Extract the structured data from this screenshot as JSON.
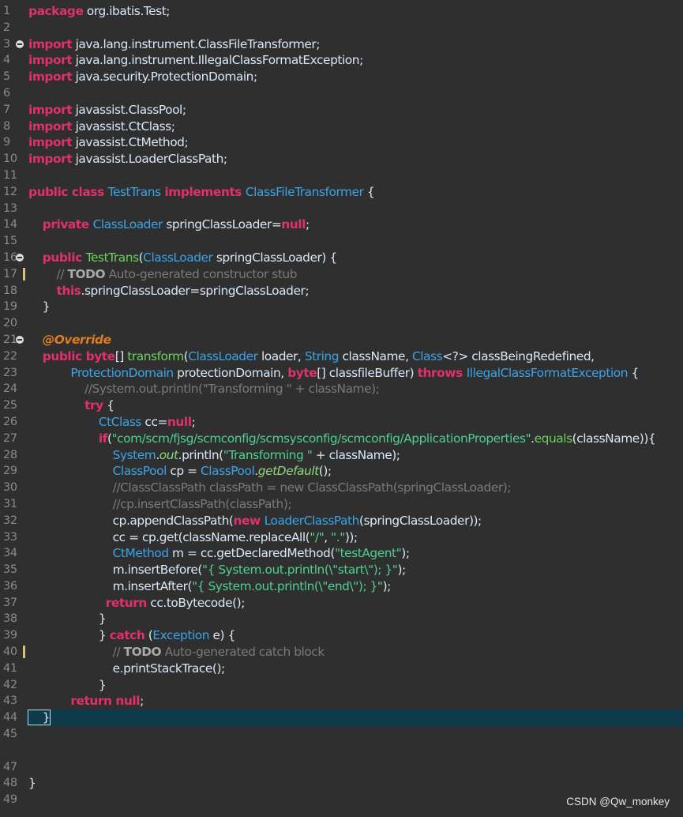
{
  "watermark": "CSDN @Qw_monkey",
  "colors": {
    "background": "#2f2f2f",
    "keyword": "#e0306e",
    "type": "#3aa4e8",
    "method": "#6fd160",
    "string": "#4fcf90",
    "comment": "#7a7a7a",
    "annotation": "#e07a1f",
    "current_line": "#0f3a4a"
  },
  "lines": [
    {
      "n": "1",
      "tokens": [
        [
          "kw",
          "package"
        ],
        [
          "plain",
          " org.ibatis.Test;"
        ]
      ]
    },
    {
      "n": "2",
      "tokens": []
    },
    {
      "n": "3",
      "fold": true,
      "tokens": [
        [
          "kw",
          "import"
        ],
        [
          "plain",
          " java.lang.instrument.ClassFileTransformer;"
        ]
      ]
    },
    {
      "n": "4",
      "tokens": [
        [
          "kw",
          "import"
        ],
        [
          "plain",
          " java.lang.instrument.IllegalClassFormatException;"
        ]
      ]
    },
    {
      "n": "5",
      "tokens": [
        [
          "kw",
          "import"
        ],
        [
          "plain",
          " java.security.ProtectionDomain;"
        ]
      ]
    },
    {
      "n": "6",
      "tokens": []
    },
    {
      "n": "7",
      "tokens": [
        [
          "kw",
          "import"
        ],
        [
          "plain",
          " javassist.ClassPool;"
        ]
      ]
    },
    {
      "n": "8",
      "tokens": [
        [
          "kw",
          "import"
        ],
        [
          "plain",
          " javassist.CtClass;"
        ]
      ]
    },
    {
      "n": "9",
      "tokens": [
        [
          "kw",
          "import"
        ],
        [
          "plain",
          " javassist.CtMethod;"
        ]
      ]
    },
    {
      "n": "10",
      "tokens": [
        [
          "kw",
          "import"
        ],
        [
          "plain",
          " javassist.LoaderClassPath;"
        ]
      ]
    },
    {
      "n": "11",
      "tokens": []
    },
    {
      "n": "12",
      "tokens": [
        [
          "kw",
          "public class "
        ],
        [
          "type",
          "TestTrans"
        ],
        [
          "kw",
          " implements "
        ],
        [
          "type",
          "ClassFileTransformer"
        ],
        [
          "plain",
          " {"
        ]
      ]
    },
    {
      "n": "13",
      "tokens": []
    },
    {
      "n": "14",
      "tokens": [
        [
          "plain",
          "    "
        ],
        [
          "kw",
          "private "
        ],
        [
          "type",
          "ClassLoader"
        ],
        [
          "plain",
          " springClassLoader="
        ],
        [
          "kw",
          "null"
        ],
        [
          "plain",
          ";"
        ]
      ]
    },
    {
      "n": "15",
      "tokens": []
    },
    {
      "n": "16",
      "fold": true,
      "tokens": [
        [
          "plain",
          "    "
        ],
        [
          "kw",
          "public "
        ],
        [
          "method",
          "TestTrans"
        ],
        [
          "plain",
          "("
        ],
        [
          "type",
          "ClassLoader"
        ],
        [
          "plain",
          " springClassLoader) {"
        ]
      ]
    },
    {
      "n": "17",
      "mark": true,
      "tokens": [
        [
          "plain",
          "        "
        ],
        [
          "cm",
          "// "
        ],
        [
          "todo",
          "TODO"
        ],
        [
          "cm",
          " Auto-generated constructor stub"
        ]
      ]
    },
    {
      "n": "18",
      "tokens": [
        [
          "plain",
          "        "
        ],
        [
          "kw",
          "this"
        ],
        [
          "plain",
          ".springClassLoader=springClassLoader;"
        ]
      ]
    },
    {
      "n": "19",
      "tokens": [
        [
          "plain",
          "    }"
        ]
      ]
    },
    {
      "n": "20",
      "tokens": []
    },
    {
      "n": "21",
      "fold": true,
      "tokens": [
        [
          "plain",
          "    "
        ],
        [
          "ann",
          "@Override"
        ]
      ]
    },
    {
      "n": "22",
      "tokens": [
        [
          "plain",
          "    "
        ],
        [
          "kw",
          "public byte"
        ],
        [
          "plain",
          "[] "
        ],
        [
          "method",
          "transform"
        ],
        [
          "plain",
          "("
        ],
        [
          "type",
          "ClassLoader"
        ],
        [
          "plain",
          " loader, "
        ],
        [
          "type",
          "String"
        ],
        [
          "plain",
          " className, "
        ],
        [
          "type",
          "Class"
        ],
        [
          "plain",
          "<?> classBeingRedefined,"
        ]
      ]
    },
    {
      "n": "23",
      "tokens": [
        [
          "plain",
          "            "
        ],
        [
          "type",
          "ProtectionDomain"
        ],
        [
          "plain",
          " protectionDomain, "
        ],
        [
          "kw",
          "byte"
        ],
        [
          "plain",
          "[] classfileBuffer) "
        ],
        [
          "kw",
          "throws "
        ],
        [
          "type",
          "IllegalClassFormatException"
        ],
        [
          "plain",
          " {"
        ]
      ]
    },
    {
      "n": "24",
      "tokens": [
        [
          "plain",
          "                "
        ],
        [
          "cm",
          "//System.out.println(\"Transforming \" + className);"
        ]
      ]
    },
    {
      "n": "25",
      "tokens": [
        [
          "plain",
          "                "
        ],
        [
          "kw",
          "try"
        ],
        [
          "plain",
          " {"
        ]
      ]
    },
    {
      "n": "26",
      "tokens": [
        [
          "plain",
          "                    "
        ],
        [
          "type",
          "CtClass"
        ],
        [
          "plain",
          " cc="
        ],
        [
          "kw",
          "null"
        ],
        [
          "plain",
          ";"
        ]
      ]
    },
    {
      "n": "27",
      "tokens": [
        [
          "plain",
          "                    "
        ],
        [
          "kw",
          "if"
        ],
        [
          "plain",
          "("
        ],
        [
          "str",
          "\"com/scm/fjsg/scmconfig/scmsysconfig/scmconfig/ApplicationProperties\""
        ],
        [
          "plain",
          "."
        ],
        [
          "method",
          "equals"
        ],
        [
          "plain",
          "(className)){"
        ]
      ]
    },
    {
      "n": "28",
      "tokens": [
        [
          "plain",
          "                        "
        ],
        [
          "type",
          "System"
        ],
        [
          "plain",
          "."
        ],
        [
          "static",
          "out"
        ],
        [
          "plain",
          ".println("
        ],
        [
          "str",
          "\"Transforming \""
        ],
        [
          "plain",
          " + className);"
        ]
      ]
    },
    {
      "n": "29",
      "tokens": [
        [
          "plain",
          "                        "
        ],
        [
          "type",
          "ClassPool"
        ],
        [
          "plain",
          " cp = "
        ],
        [
          "type",
          "ClassPool"
        ],
        [
          "plain",
          "."
        ],
        [
          "static",
          "getDefault"
        ],
        [
          "plain",
          "();"
        ]
      ]
    },
    {
      "n": "30",
      "tokens": [
        [
          "plain",
          "                        "
        ],
        [
          "cm",
          "//ClassClassPath classPath = new ClassClassPath(springClassLoader);"
        ]
      ]
    },
    {
      "n": "31",
      "tokens": [
        [
          "plain",
          "                        "
        ],
        [
          "cm",
          "//cp.insertClassPath(classPath);"
        ]
      ]
    },
    {
      "n": "32",
      "tokens": [
        [
          "plain",
          "                        cp.appendClassPath("
        ],
        [
          "kw",
          "new "
        ],
        [
          "type",
          "LoaderClassPath"
        ],
        [
          "plain",
          "(springClassLoader));"
        ]
      ]
    },
    {
      "n": "33",
      "tokens": [
        [
          "plain",
          "                        cc = cp.get(className.replaceAll("
        ],
        [
          "str",
          "\"/\""
        ],
        [
          "plain",
          ", "
        ],
        [
          "str",
          "\".\""
        ],
        [
          "plain",
          "));"
        ]
      ]
    },
    {
      "n": "34",
      "tokens": [
        [
          "plain",
          "                        "
        ],
        [
          "type",
          "CtMethod"
        ],
        [
          "plain",
          " m = cc.getDeclaredMethod("
        ],
        [
          "str",
          "\"testAgent\""
        ],
        [
          "plain",
          ");"
        ]
      ]
    },
    {
      "n": "35",
      "tokens": [
        [
          "plain",
          "                        m.insertBefore("
        ],
        [
          "str",
          "\"{ System.out.println(\\\"start\\\"); }\""
        ],
        [
          "plain",
          ");"
        ]
      ]
    },
    {
      "n": "36",
      "tokens": [
        [
          "plain",
          "                        m.insertAfter("
        ],
        [
          "str",
          "\"{ System.out.println(\\\"end\\\"); }\""
        ],
        [
          "plain",
          ");"
        ]
      ]
    },
    {
      "n": "37",
      "tokens": [
        [
          "plain",
          "                      "
        ],
        [
          "kw",
          "return"
        ],
        [
          "plain",
          " cc.toBytecode();"
        ]
      ]
    },
    {
      "n": "38",
      "tokens": [
        [
          "plain",
          "                    }"
        ]
      ]
    },
    {
      "n": "39",
      "tokens": [
        [
          "plain",
          "                    } "
        ],
        [
          "kw",
          "catch"
        ],
        [
          "plain",
          " ("
        ],
        [
          "type",
          "Exception"
        ],
        [
          "plain",
          " e) {"
        ]
      ]
    },
    {
      "n": "40",
      "mark": true,
      "tokens": [
        [
          "plain",
          "                        "
        ],
        [
          "cm",
          "// "
        ],
        [
          "todo",
          "TODO"
        ],
        [
          "cm",
          " Auto-generated catch block"
        ]
      ]
    },
    {
      "n": "41",
      "tokens": [
        [
          "plain",
          "                        e.printStackTrace();"
        ]
      ]
    },
    {
      "n": "42",
      "tokens": [
        [
          "plain",
          "                    }"
        ]
      ]
    },
    {
      "n": "43",
      "tokens": [
        [
          "plain",
          "            "
        ],
        [
          "kw",
          "return null"
        ],
        [
          "plain",
          ";"
        ]
      ]
    },
    {
      "n": "44",
      "current": true,
      "tokens": [
        [
          "plain",
          "    }"
        ]
      ]
    },
    {
      "n": "45",
      "tokens": []
    },
    {
      "n": "",
      "tokens": []
    },
    {
      "n": "47",
      "tokens": []
    },
    {
      "n": "48",
      "tokens": [
        [
          "plain",
          "}"
        ]
      ]
    },
    {
      "n": "49",
      "tokens": []
    }
  ]
}
